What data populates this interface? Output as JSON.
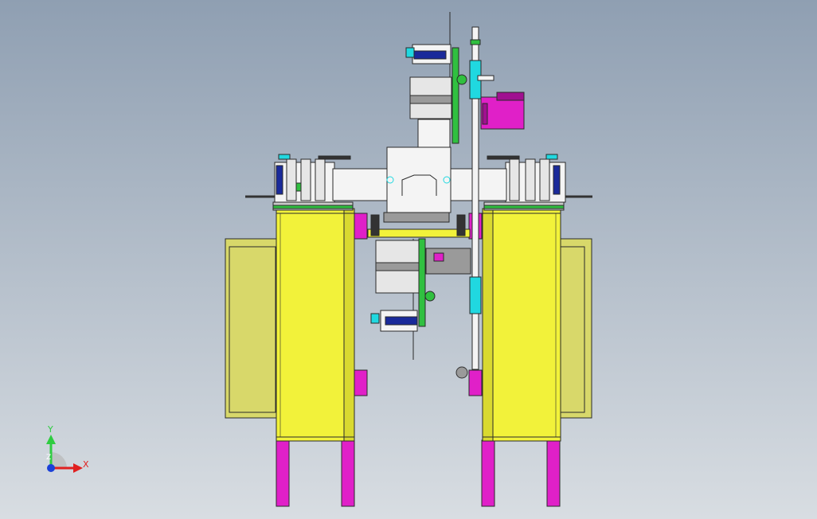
{
  "viewport": {
    "background_top": "#8f9fb2",
    "background_bottom": "#d8dde2"
  },
  "colors": {
    "yellow": "#f2f23a",
    "yellow_shade": "#d9d930",
    "panel_olive": "#d8d86a",
    "magenta": "#e020c8",
    "magenta_dark": "#a01090",
    "cyan": "#20d8e0",
    "green": "#30c040",
    "navy": "#1a2a9a",
    "white_part": "#f4f4f4",
    "grey_part": "#9a9a9a",
    "dark_line": "#333333",
    "outline": "#2a2a2a"
  },
  "triad": {
    "y_label": "Y",
    "x_label": "X",
    "z_label": "Z",
    "y_color": "#2ecc40",
    "x_color": "#e02020",
    "origin_color": "#1a40d8"
  }
}
